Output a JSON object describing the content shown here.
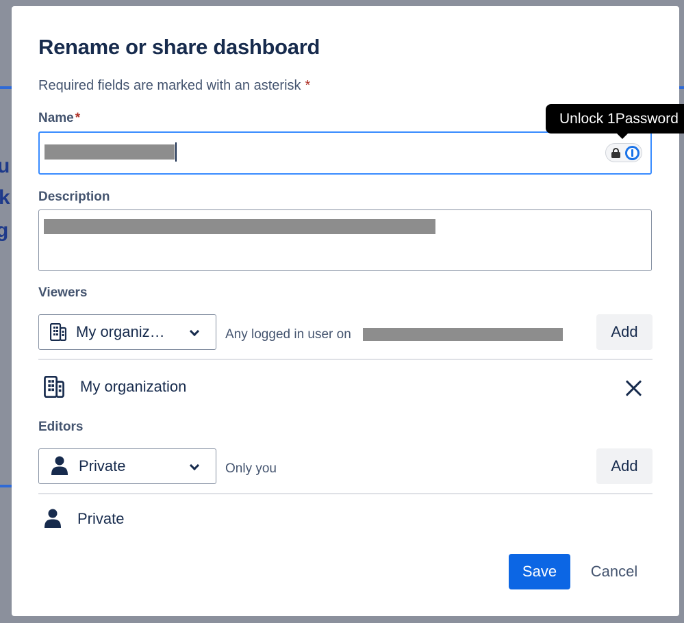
{
  "dialog": {
    "title": "Rename or share dashboard",
    "required_note": "Required fields are marked with an asterisk",
    "required_marker": "*"
  },
  "name_field": {
    "label": "Name",
    "required_marker": "*"
  },
  "password_manager": {
    "tooltip": "Unlock 1Password",
    "icons": [
      "lock-icon",
      "1password-icon"
    ]
  },
  "description_field": {
    "label": "Description"
  },
  "viewers": {
    "label": "Viewers",
    "select_value": "My organiz…",
    "hint": "Any logged in user on",
    "add_label": "Add",
    "items": [
      {
        "label": "My organization",
        "icon": "building-icon"
      }
    ]
  },
  "editors": {
    "label": "Editors",
    "select_value": "Private",
    "hint": "Only you",
    "add_label": "Add",
    "items": [
      {
        "label": "Private",
        "icon": "person-icon"
      }
    ]
  },
  "actions": {
    "save_label": "Save",
    "cancel_label": "Cancel"
  },
  "colors": {
    "primary": "#0c66e4",
    "focus_border": "#388bff",
    "required": "#ae2e24",
    "heading": "#172b4d"
  }
}
